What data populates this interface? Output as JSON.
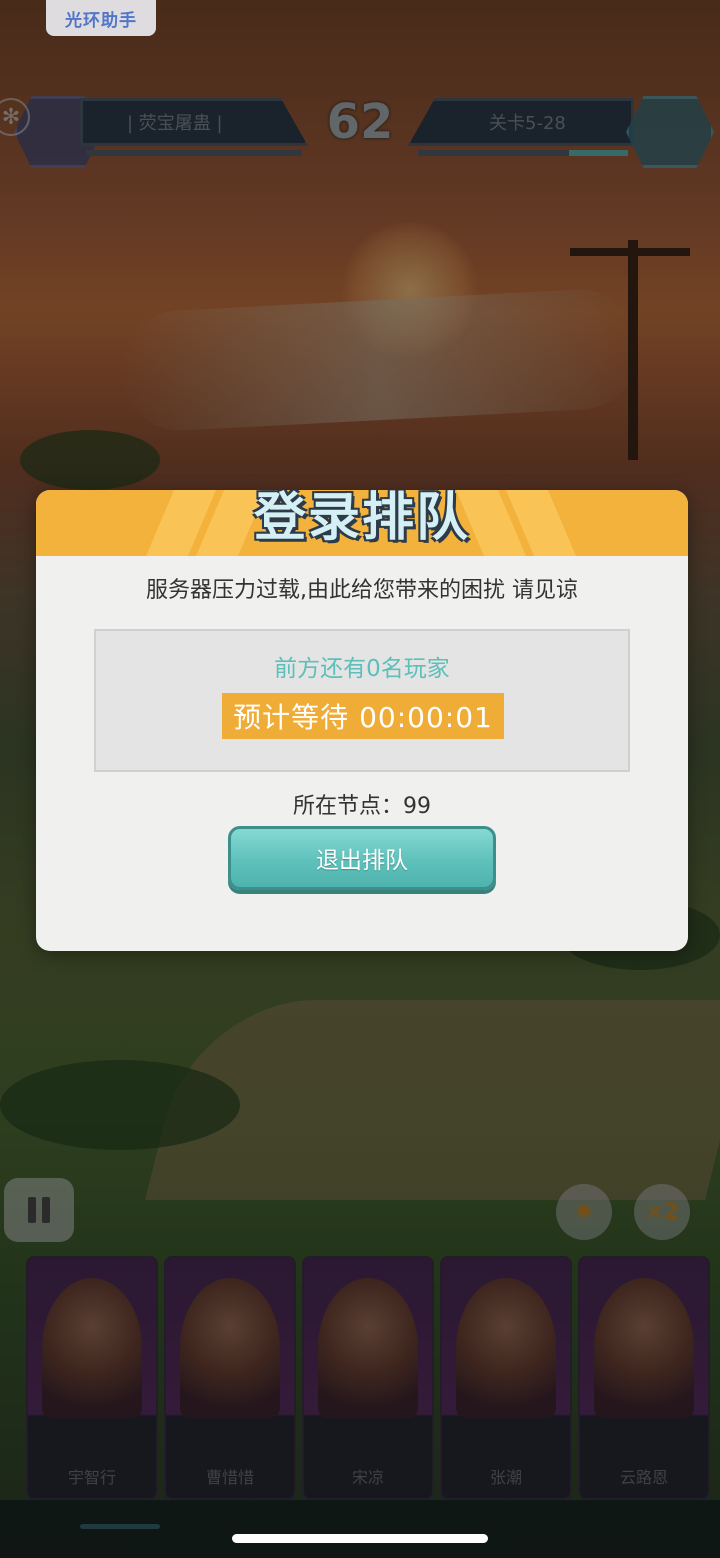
{
  "helper": {
    "label": "光环助手"
  },
  "hud": {
    "left_name": "| 荧宝屠蛊 |",
    "right_name": "关卡5-28",
    "score": "62",
    "right_hp_fraction": 0.28
  },
  "controls": {
    "pause_icon": "pause-icon",
    "gear_icon": "gear-icon",
    "speed_label": "×2"
  },
  "cards": [
    {
      "name": "宇智行"
    },
    {
      "name": "曹惜惜"
    },
    {
      "name": "宋凉"
    },
    {
      "name": "张潮"
    },
    {
      "name": "云路恩"
    }
  ],
  "modal": {
    "title": "登录排队",
    "message": "服务器压力过载,由此给您带来的困扰 请见谅",
    "queue_ahead": "前方还有0名玩家",
    "wait_label": "预计等待 00:00:01",
    "node_label": "所在节点：99",
    "exit_button": "退出排队"
  },
  "colors": {
    "accent_orange": "#f2b23b",
    "teal": "#5fc1bb"
  }
}
